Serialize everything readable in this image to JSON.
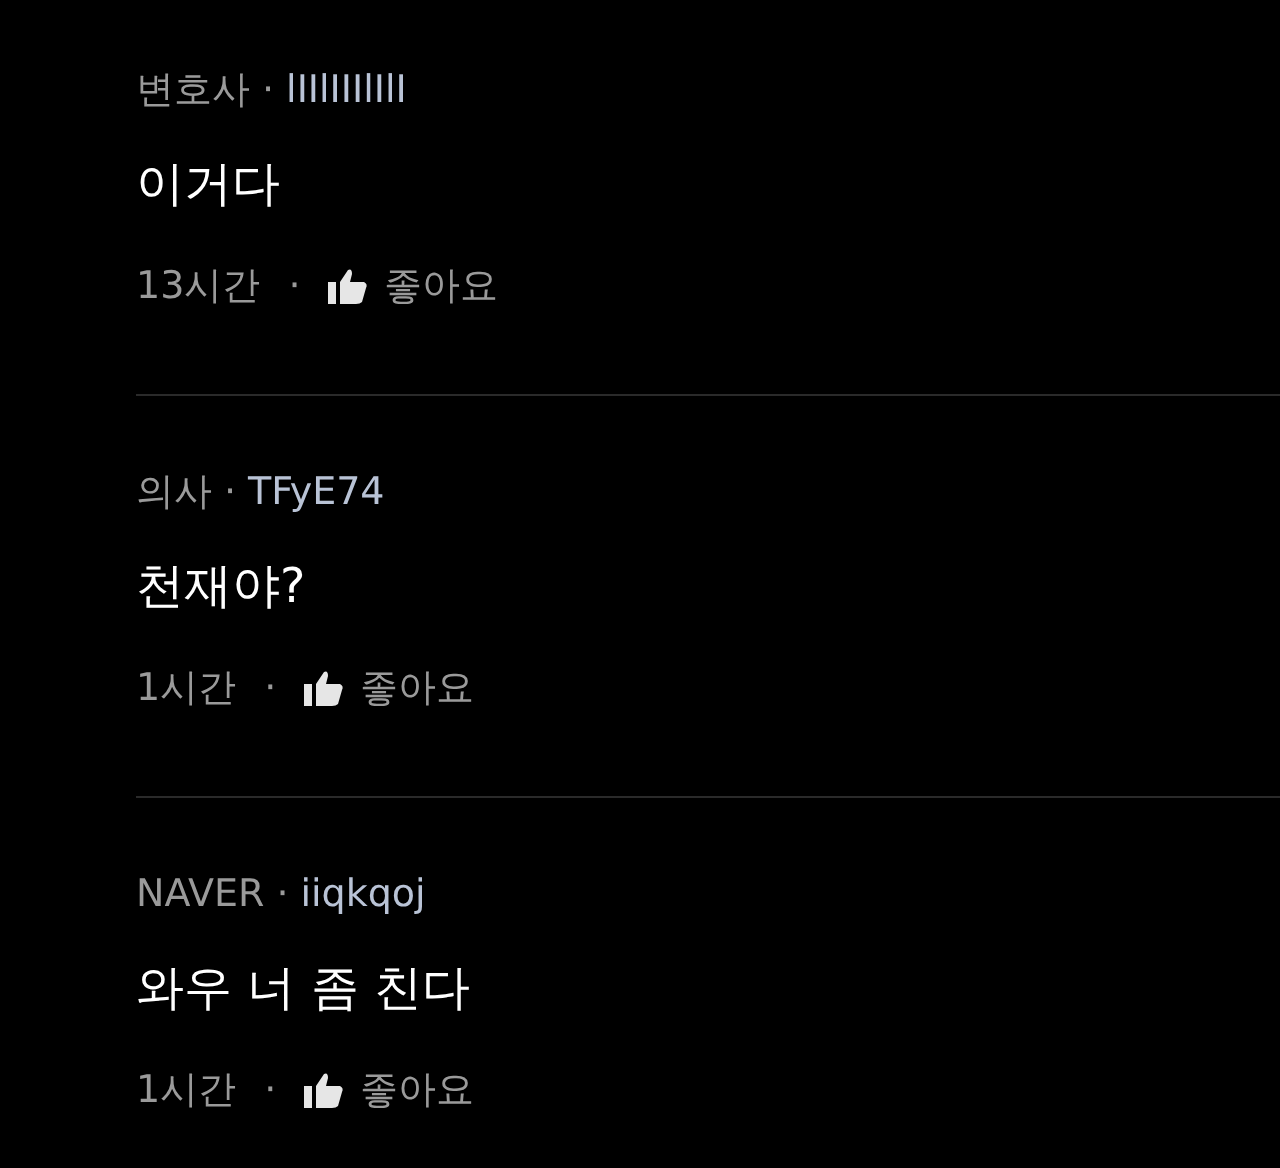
{
  "comments": [
    {
      "author": "변호사",
      "separator": "·",
      "user_id": "lIIlIIIlIlI",
      "text": "이거다",
      "time": "13시간",
      "dot": "·",
      "like_label": "좋아요"
    },
    {
      "author": "의사",
      "separator": "·",
      "user_id": "TFyE74",
      "text": "천재야?",
      "time": "1시간",
      "dot": "·",
      "like_label": "좋아요"
    },
    {
      "author": "NAVER",
      "separator": "·",
      "user_id": "iiqkqoj",
      "text": "와우 너 좀 친다",
      "time": "1시간",
      "dot": "·",
      "like_label": "좋아요"
    }
  ]
}
